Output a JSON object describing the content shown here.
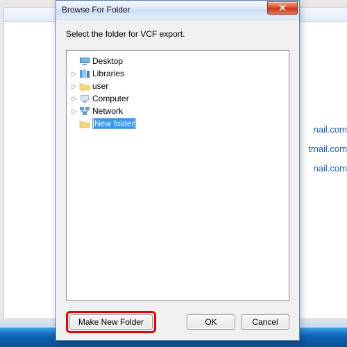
{
  "dialog": {
    "title": "Browse For Folder",
    "instruction": "Select the folder for VCF export."
  },
  "tree": {
    "desktop": "Desktop",
    "libraries": "Libraries",
    "user": "user",
    "computer": "Computer",
    "network": "Network",
    "newfolder": "New folder"
  },
  "buttons": {
    "make_new_folder": "Make New Folder",
    "ok": "OK",
    "cancel": "Cancel"
  },
  "background": {
    "email_suffix1": "nail.com",
    "email_suffix2": "tmail.com",
    "email_suffix3": "nail.com"
  }
}
